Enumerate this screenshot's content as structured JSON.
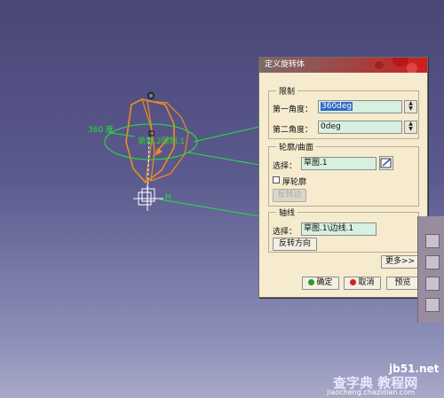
{
  "viewport": {
    "dimension_label": "360 度",
    "limit_label": "第制.2限制.1",
    "axis_h_label": "H",
    "colors": {
      "profile": "#f08a20",
      "construction": "#22e53a",
      "background": "#4a4677"
    }
  },
  "dialog": {
    "title": "定义旋转体",
    "limits": {
      "group_title": "限制",
      "first_angle_label": "第一角度：",
      "first_angle_value": "360deg",
      "second_angle_label": "第二角度：",
      "second_angle_value": "0deg"
    },
    "profile": {
      "group_title": "轮廓/曲面",
      "selection_label": "选择：",
      "selection_value": "草图.1",
      "thick_profile_label": "厚轮廓",
      "reverse_side_label": "反转边"
    },
    "axis": {
      "group_title": "轴线",
      "selection_label": "选择：",
      "selection_value": "草图.1\\边线.1",
      "reverse_direction_label": "反转方向"
    },
    "more_label": "更多>>",
    "ok_label": "确定",
    "cancel_label": "取消",
    "preview_label": "预览"
  },
  "watermark": {
    "site": "jb51.net",
    "text": "查字典 教程网",
    "url": "jiaocheng.chazidian.com"
  }
}
